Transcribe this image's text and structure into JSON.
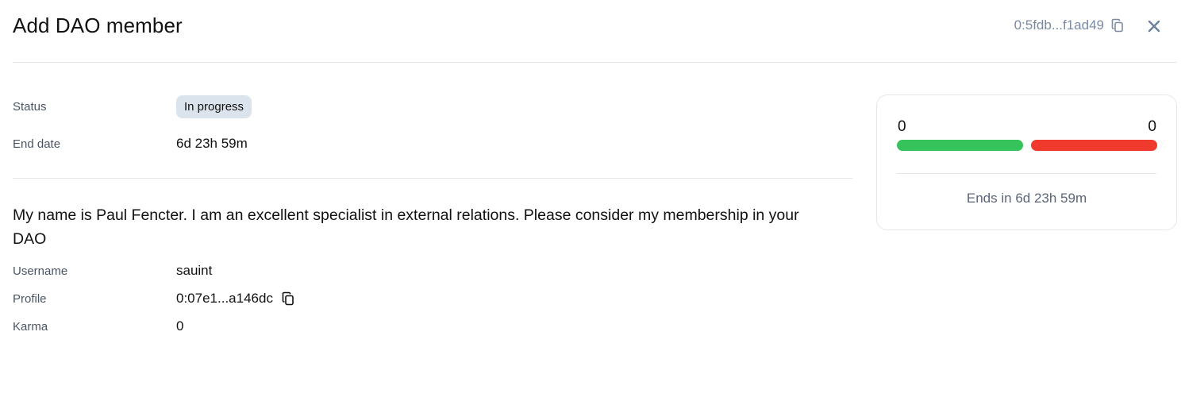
{
  "header": {
    "title": "Add DAO member",
    "address": "0:5fdb...f1ad49"
  },
  "details": {
    "status_label": "Status",
    "status_value": "In progress",
    "end_date_label": "End date",
    "end_date_value": "6d 23h 59m"
  },
  "description": "My name is Paul Fencter. I am an excellent specialist in external relations. Please consider my membership in your DAO",
  "member": {
    "username_label": "Username",
    "username_value": "sauint",
    "profile_label": "Profile",
    "profile_value": "0:07e1...a146dc",
    "karma_label": "Karma",
    "karma_value": "0"
  },
  "votes": {
    "yes_count": "0",
    "no_count": "0",
    "ends_text": "Ends in 6d 23h 59m",
    "yes_color": "#36c35b",
    "no_color": "#f03a2e"
  },
  "icons": {
    "copy": "copy-icon",
    "close": "close-icon"
  }
}
